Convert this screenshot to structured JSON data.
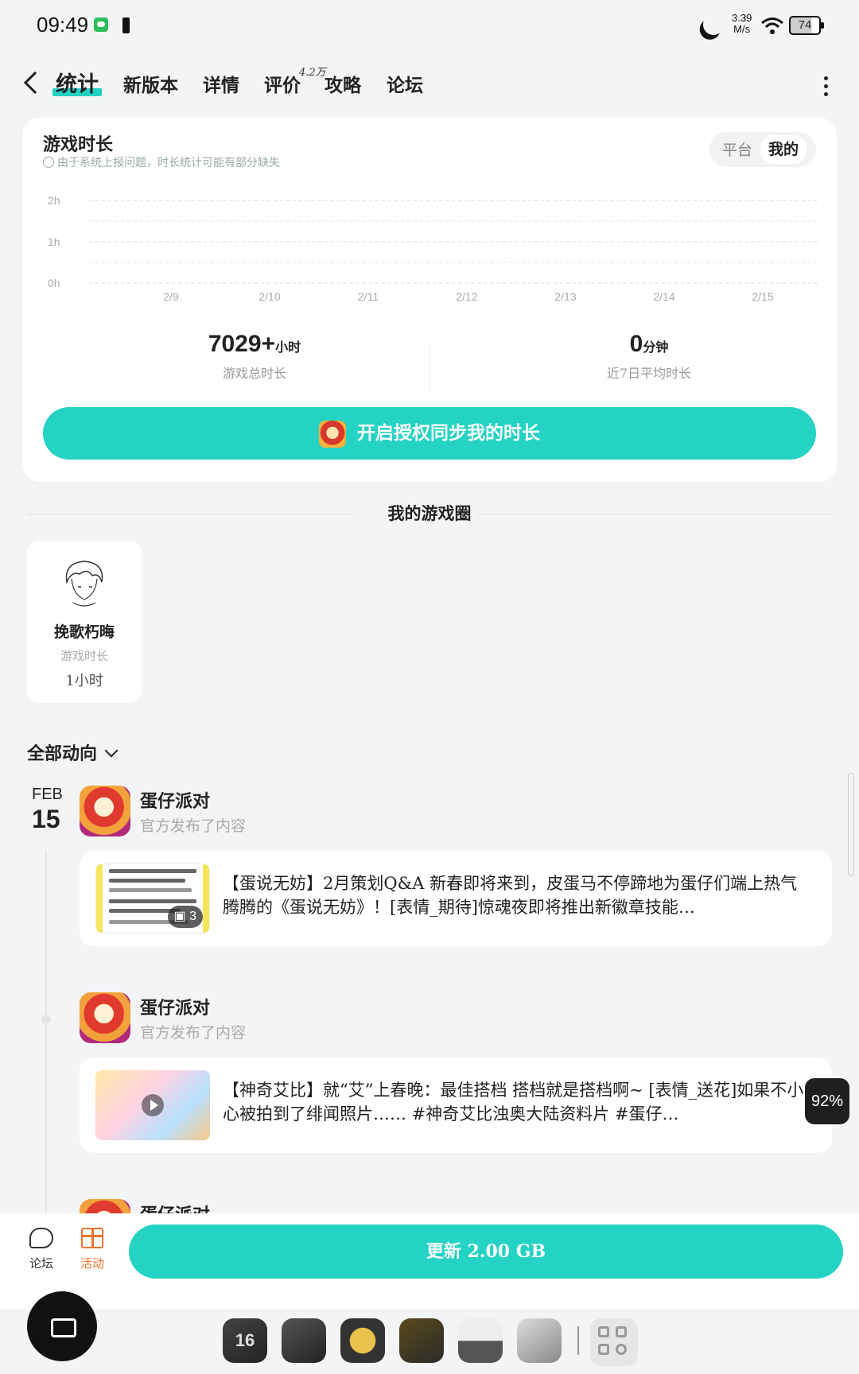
{
  "status": {
    "time": "09:49",
    "speed_value": "3.39",
    "speed_unit": "M/s",
    "battery": "74"
  },
  "nav": {
    "tabs": [
      "统计",
      "新版本",
      "详情",
      "评价",
      "攻略",
      "论坛"
    ],
    "active_tab": "统计",
    "review_count": "4.2万"
  },
  "playtime_card": {
    "title": "游戏时长",
    "note": "由于系统上报问题，时长统计可能有部分缺失",
    "toggle": [
      "平台",
      "我的"
    ],
    "toggle_selected": "我的",
    "total_value": "7029+",
    "total_unit": "小时",
    "total_label": "游戏总时长",
    "avg_value": "0",
    "avg_unit": "分钟",
    "avg_label": "近7日平均时长",
    "sync_button": "开启授权同步我的时长"
  },
  "chart_data": {
    "type": "bar",
    "categories": [
      "2/9",
      "2/10",
      "2/11",
      "2/12",
      "2/13",
      "2/14",
      "2/15"
    ],
    "values": [
      0,
      0,
      0,
      0,
      0,
      0,
      0
    ],
    "y_ticks": [
      "2h",
      "1h",
      "0h"
    ],
    "ylim": [
      0,
      2
    ],
    "grid": true,
    "colors": {
      "accent": "#24d3c4"
    }
  },
  "circle": {
    "title": "我的游戏圈",
    "friend": {
      "name": "挽歌朽晦",
      "label": "游戏时长",
      "value": "1小时"
    }
  },
  "feed": {
    "filter": "全部动向",
    "date_month": "FEB",
    "date_day": "15",
    "posts": [
      {
        "game": "蛋仔派对",
        "subtitle": "官方发布了内容",
        "text": "【蛋说无妨】2月策划Q&A 新春即将来到，皮蛋马不停蹄地为蛋仔们端上热气腾腾的《蛋说无妨》！[表情_期待]惊魂夜即将推出新徽章技能…",
        "image_count": "3"
      },
      {
        "game": "蛋仔派对",
        "subtitle": "官方发布了内容",
        "text": "【神奇艾比】就“艾”上春晚：最佳搭档 搭档就是搭档啊~ [表情_送花]如果不小心被拍到了绯闻照片…… #神奇艾比浊奥大陆资料片 #蛋仔…"
      },
      {
        "game": "蛋仔派对"
      }
    ]
  },
  "overlay_percent": "92%",
  "action_bar": {
    "forum": "论坛",
    "event": "活动",
    "update": "更新 2.00 GB"
  },
  "dock": {
    "calendar_day": "16"
  }
}
